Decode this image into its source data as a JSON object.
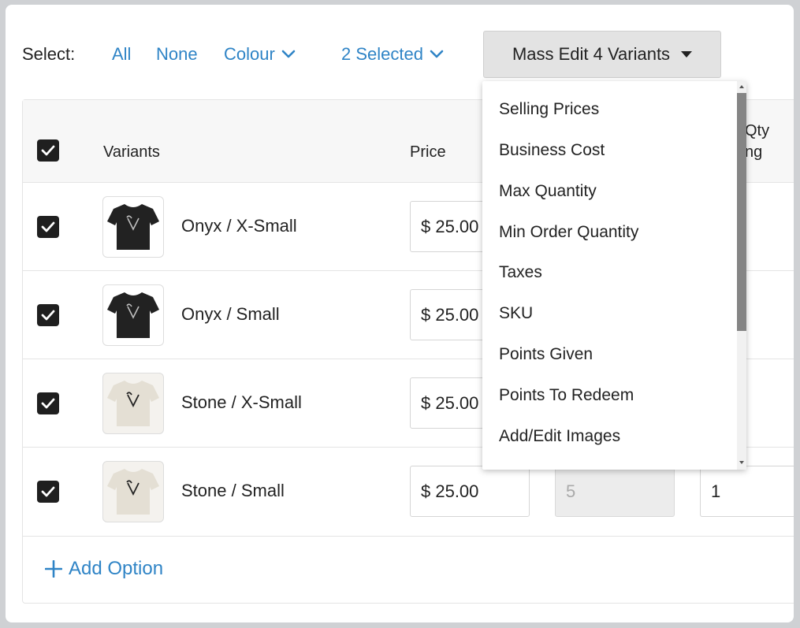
{
  "select_bar": {
    "label": "Select:",
    "all": "All",
    "none": "None",
    "colour": "Colour",
    "selected": "2 Selected",
    "mass_edit": "Mass Edit 4 Variants"
  },
  "table": {
    "headers": {
      "variants": "Variants",
      "price": "Price",
      "qty_partial_top": "Qty",
      "qty_partial_bottom": "ng"
    },
    "rows": [
      {
        "name": "Onyx / X-Small",
        "price": "$ 25.00",
        "shirt_color": "#222222",
        "logo_color": "#bfbfbf"
      },
      {
        "name": "Onyx / Small",
        "price": "$ 25.00",
        "shirt_color": "#222222",
        "logo_color": "#bfbfbf"
      },
      {
        "name": "Stone / X-Small",
        "price": "$ 25.00",
        "shirt_color": "#e4dfd4",
        "logo_color": "#222222"
      },
      {
        "name": "Stone / Small",
        "price": "$ 25.00",
        "qty_disabled": "5",
        "qty_min": "1",
        "shirt_color": "#e4dfd4",
        "logo_color": "#222222"
      }
    ],
    "add_option": "Add Option"
  },
  "mass_edit_menu": {
    "items": [
      "Selling Prices",
      "Business Cost",
      "Max Quantity",
      "Min Order Quantity",
      "Taxes",
      "SKU",
      "Points Given",
      "Points To Redeem",
      "Add/Edit Images"
    ]
  },
  "colors": {
    "link": "#2f84c6",
    "checkbox": "#1f1f1f"
  }
}
